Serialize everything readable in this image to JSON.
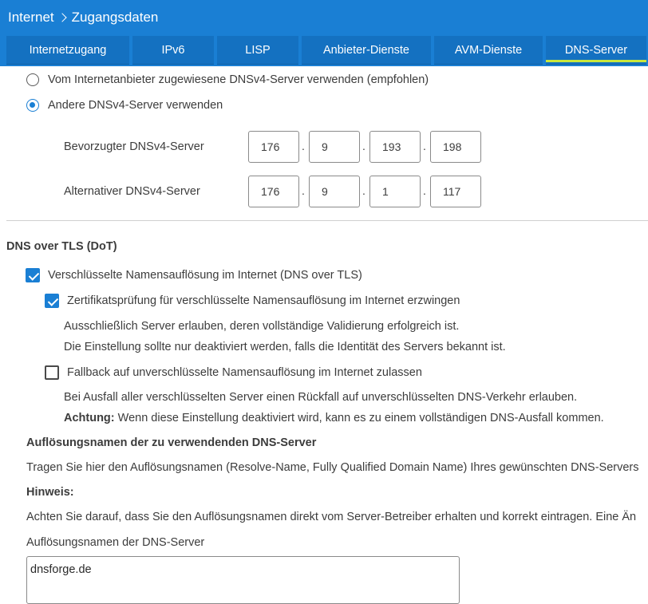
{
  "breadcrumb": {
    "section": "Internet",
    "page": "Zugangsdaten"
  },
  "tabs": [
    {
      "label": "Internetzugang",
      "active": false
    },
    {
      "label": "IPv6",
      "active": false
    },
    {
      "label": "LISP",
      "active": false
    },
    {
      "label": "Anbieter-Dienste",
      "active": false
    },
    {
      "label": "AVM-Dienste",
      "active": false
    },
    {
      "label": "DNS-Server",
      "active": true
    }
  ],
  "dns_source": {
    "option_provider": {
      "label": "Vom Internetanbieter zugewiesene DNSv4-Server verwenden (empfohlen)",
      "checked": false
    },
    "option_other": {
      "label": "Andere DNSv4-Server verwenden",
      "checked": true
    }
  },
  "preferred_dns": {
    "label": "Bevorzugter DNSv4-Server",
    "octets": [
      "176",
      "9",
      "193",
      "198"
    ]
  },
  "alternative_dns": {
    "label": "Alternativer DNSv4-Server",
    "octets": [
      "176",
      "9",
      "1",
      "117"
    ]
  },
  "ip_separator": ".",
  "dot_section": {
    "title": "DNS over TLS (DoT)",
    "encrypted": {
      "label": "Verschlüsselte Namensauflösung im Internet (DNS over TLS)",
      "checked": true
    },
    "cert_check": {
      "label": "Zertifikatsprüfung für verschlüsselte Namensauflösung im Internet erzwingen",
      "checked": true,
      "desc1": "Ausschließlich Server erlauben, deren vollständige Validierung erfolgreich ist.",
      "desc2": "Die Einstellung sollte nur deaktiviert werden, falls die Identität des Servers bekannt ist."
    },
    "fallback": {
      "label": "Fallback auf unverschlüsselte Namensauflösung im Internet zulassen",
      "checked": false,
      "desc1": "Bei Ausfall aller verschlüsselten Server einen Rückfall auf unverschlüsselten DNS-Verkehr erlauben.",
      "warning_label": "Achtung:",
      "warning_text": " Wenn diese Einstellung deaktiviert wird, kann es zu einem vollständigen DNS-Ausfall kommen."
    }
  },
  "resolve_names": {
    "title": "Auflösungsnamen der zu verwendenden DNS-Server",
    "desc": "Tragen Sie hier den Auflösungsnamen (Resolve-Name, Fully Qualified Domain Name) Ihres gewünschten DNS-Servers",
    "hint_title": "Hinweis:",
    "hint_text": "Achten Sie darauf, dass Sie den Auflösungsnamen direkt vom Server-Betreiber erhalten und korrekt eintragen. Eine Än",
    "field_label": "Auflösungsnamen der DNS-Server",
    "field_value": "dnsforge.de"
  }
}
